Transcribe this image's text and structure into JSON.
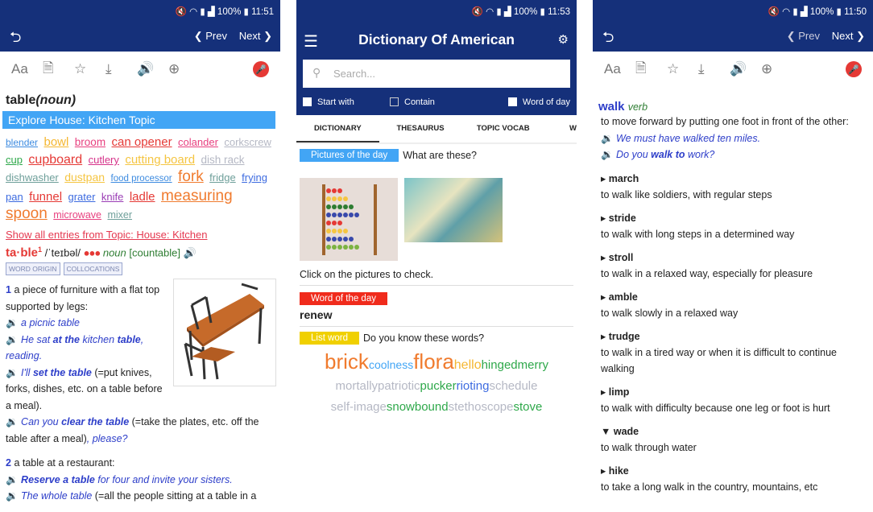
{
  "status": [
    {
      "battery": "100%",
      "time": "11:51"
    },
    {
      "battery": "100%",
      "time": "11:53"
    },
    {
      "battery": "100%",
      "time": "11:50"
    }
  ],
  "nav": {
    "prev": "Prev",
    "next": "Next"
  },
  "colors": {
    "navy": "#15307a",
    "banner": "#42a5f5",
    "red": "#e53935",
    "link_blue": "#2d3ec9",
    "green": "#2e7d32"
  },
  "panel1": {
    "headword": "table",
    "headword_pos": "(noun)",
    "banner": "Explore House: Kitchen Topic",
    "topic_words": [
      {
        "t": "blender",
        "c": "#3d8be0",
        "s": 12
      },
      {
        "t": "bowl",
        "c": "#f5b731",
        "s": 15
      },
      {
        "t": "broom",
        "c": "#e8407f",
        "s": 13.5
      },
      {
        "t": "can opener",
        "c": "#e53935",
        "s": 15
      },
      {
        "t": "colander",
        "c": "#e8407f",
        "s": 13
      },
      {
        "t": "corkscrew",
        "c": "#b5b8c4",
        "s": 13
      },
      {
        "t": "cup",
        "c": "#2ea84a",
        "s": 13
      },
      {
        "t": "cupboard",
        "c": "#e53935",
        "s": 16
      },
      {
        "t": "cutlery",
        "c": "#d6338a",
        "s": 13
      },
      {
        "t": "cutting board",
        "c": "#f5c542",
        "s": 15
      },
      {
        "t": "dish rack",
        "c": "#b5b8c4",
        "s": 13.5
      },
      {
        "t": "dishwasher",
        "c": "#6e9f9a",
        "s": 13
      },
      {
        "t": "dustpan",
        "c": "#f5c542",
        "s": 14
      },
      {
        "t": "food processor",
        "c": "#3d8be0",
        "s": 11.5
      },
      {
        "t": "fork",
        "c": "#f07b2e",
        "s": 19
      },
      {
        "t": "fridge",
        "c": "#6e9f9a",
        "s": 13
      },
      {
        "t": "frying pan",
        "c": "#3d6be0",
        "s": 13
      },
      {
        "t": "funnel",
        "c": "#e53935",
        "s": 15
      },
      {
        "t": "grater",
        "c": "#3d6be0",
        "s": 13
      },
      {
        "t": "knife",
        "c": "#9a3db5",
        "s": 13
      },
      {
        "t": "ladle",
        "c": "#e53935",
        "s": 15
      },
      {
        "t": "measuring spoon",
        "c": "#f07b2e",
        "s": 19
      },
      {
        "t": "microwave",
        "c": "#e8407f",
        "s": 12.5
      },
      {
        "t": "mixer",
        "c": "#6e9f9a",
        "s": 12.5
      }
    ],
    "show_all": "Show all entries from Topic: House: Kitchen",
    "entry": {
      "word": "ta·ble",
      "sup": "1",
      "pron": "/ˈteɪbəl/",
      "dots": "●●●",
      "pos": "noun",
      "grammar": "[countable]"
    },
    "tags": [
      "WORD ORIGIN",
      "COLLOCATIONS"
    ],
    "sense1": {
      "num": "1",
      "def": "a piece of furniture with a flat top supported by legs:",
      "examples": [
        [
          {
            "t": "a picnic table"
          }
        ],
        [
          {
            "t": "He sat "
          },
          {
            "t": "at the",
            "b": true
          },
          {
            "t": " kitchen "
          },
          {
            "t": "table",
            "b": true
          },
          {
            "t": ", reading."
          }
        ],
        [
          {
            "t": "I'll "
          },
          {
            "t": "set the table",
            "b": true
          },
          {
            "t": " (=put knives, forks, dishes, etc. on a table before a meal).",
            "plain": true
          }
        ],
        [
          {
            "t": "Can you "
          },
          {
            "t": "clear the table",
            "b": true
          },
          {
            "t": " (=take the plates, etc. off the table after a meal)",
            "plain": true
          },
          {
            "t": ", please?"
          }
        ]
      ]
    },
    "sense2": {
      "num": "2",
      "def": "a table at a restaurant:",
      "examples": [
        [
          {
            "t": "Reserve a table",
            "b": true
          },
          {
            "t": " for four and invite your sisters."
          }
        ],
        [
          {
            "t": "The whole table"
          },
          {
            "t": " (=all the people sitting at a table in a",
            "plain": true
          }
        ]
      ]
    }
  },
  "panel2": {
    "title": "Dictionary Of American",
    "search_placeholder": "Search...",
    "checks": [
      {
        "label": "Start with",
        "checked": false
      },
      {
        "label": "Contain",
        "checked": false
      },
      {
        "label": "Word of day",
        "checked": false
      }
    ],
    "tabs": [
      "DICTIONARY",
      "THESAURUS",
      "TOPIC VOCAB",
      "W"
    ],
    "pictures": {
      "label": "Pictures of the day",
      "question": "What are these?",
      "hint": "Click on the pictures to check."
    },
    "wotd": {
      "label": "Word of the day",
      "word": "renew"
    },
    "list": {
      "label": "List word",
      "question": "Do you know these words?",
      "words": [
        [
          {
            "t": "brick",
            "c": "#f07b2e",
            "s": 26
          },
          {
            "t": "coolness",
            "c": "#42a5f5",
            "s": 14
          },
          {
            "t": "flora",
            "c": "#f07b2e",
            "s": 26
          },
          {
            "t": "hello",
            "c": "#f5b731",
            "s": 16
          },
          {
            "t": "hingedmerry",
            "c": "#2ea84a",
            "s": 15
          }
        ],
        [
          {
            "t": "mortallypatriotic",
            "c": "#b5b8c4",
            "s": 15
          },
          {
            "t": "pucker",
            "c": "#2ea84a",
            "s": 15
          },
          {
            "t": "rioting",
            "c": "#3d6be0",
            "s": 15
          },
          {
            "t": "schedule",
            "c": "#b5b8c4",
            "s": 15
          }
        ],
        [
          {
            "t": "self-image",
            "c": "#b5b8c4",
            "s": 15
          },
          {
            "t": "snowbound",
            "c": "#2ea84a",
            "s": 15
          },
          {
            "t": "stethoscope",
            "c": "#b5b8c4",
            "s": 15
          },
          {
            "t": "stove",
            "c": "#2ea84a",
            "s": 15
          }
        ]
      ]
    }
  },
  "panel3": {
    "word": "walk",
    "pos": "verb",
    "def": "to move forward by putting one foot in front of the other:",
    "examples": [
      [
        {
          "t": "We must have walked ten miles."
        }
      ],
      [
        {
          "t": "Do you "
        },
        {
          "t": "walk to",
          "b": true
        },
        {
          "t": " work?"
        }
      ]
    ],
    "synonyms": [
      {
        "marker": "▸",
        "word": "march",
        "def": "to walk like soldiers, with regular steps"
      },
      {
        "marker": "▸",
        "word": "stride",
        "def": "to walk with long steps in a determined way"
      },
      {
        "marker": "▸",
        "word": "stroll",
        "def": "to walk in a relaxed way, especially for pleasure"
      },
      {
        "marker": "▸",
        "word": "amble",
        "def": "to walk slowly in a relaxed way"
      },
      {
        "marker": "▸",
        "word": "trudge",
        "def": "to walk in a tired way or when it is difficult to continue walking"
      },
      {
        "marker": "▸",
        "word": "limp",
        "def": "to walk with difficulty because one leg or foot is hurt"
      },
      {
        "marker": "▼",
        "word": "wade",
        "def": "to walk through water"
      },
      {
        "marker": "▸",
        "word": "hike",
        "def": "to take a long walk in the country, mountains, etc"
      }
    ]
  }
}
